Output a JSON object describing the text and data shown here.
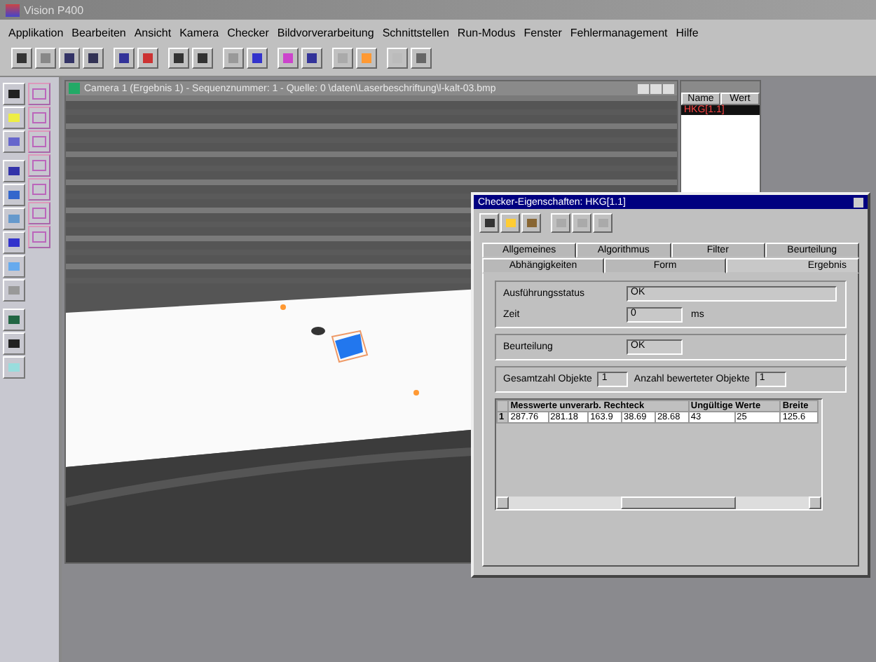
{
  "window": {
    "title": "Vision P400"
  },
  "menu": [
    "Applikation",
    "Bearbeiten",
    "Ansicht",
    "Kamera",
    "Checker",
    "Bildvorverarbeitung",
    "Schnittstellen",
    "Run-Modus",
    "Fenster",
    "Fehlermanagement",
    "Hilfe"
  ],
  "image_window": {
    "title": "Camera 1 (Ergebnis 1) - Sequenznummer: 1 - Quelle: 0 \\daten\\Laserbeschriftung\\l-kalt-03.bmp"
  },
  "checker_list": {
    "columns": [
      "Name",
      "Wert"
    ],
    "rows": [
      {
        "name": "HKG[1.1]",
        "selected": true
      }
    ]
  },
  "dialog": {
    "title": "Checker-Eigenschaften: HKG[1.1]",
    "tabs": [
      [
        {
          "label": "Allgemeines",
          "selected": false
        },
        {
          "label": "Algorithmus",
          "selected": false
        },
        {
          "label": "Filter",
          "selected": false
        },
        {
          "label": "Beurteilung",
          "selected": false
        }
      ],
      [
        {
          "label": "Abhängigkeiten",
          "selected": false
        },
        {
          "label": "Form",
          "selected": false
        },
        {
          "label": "Ergebnis",
          "selected": true
        }
      ]
    ],
    "fields": [
      {
        "label": "Ausführungsstatus",
        "value": "OK"
      },
      {
        "label": "Zeit",
        "value": "0",
        "unit": "ms"
      },
      {
        "label": "Beurteilung",
        "value": "OK"
      }
    ],
    "counts": [
      {
        "label": "Gesamtzahl Objekte",
        "value": "1"
      },
      {
        "label": "Anzahl bewerteter Objekte",
        "value": "1"
      }
    ],
    "table": {
      "header_groups": [
        {
          "label": "Messwerte unverarb. Rechteck"
        },
        {
          "label": "Ungültige Werte"
        },
        {
          "label": "Breite"
        }
      ],
      "rows": [
        {
          "index": "1",
          "cells": [
            "287.76",
            "281.18",
            "163.9",
            "38.69",
            "28.68",
            "43",
            "25",
            "125.6"
          ]
        }
      ]
    }
  }
}
